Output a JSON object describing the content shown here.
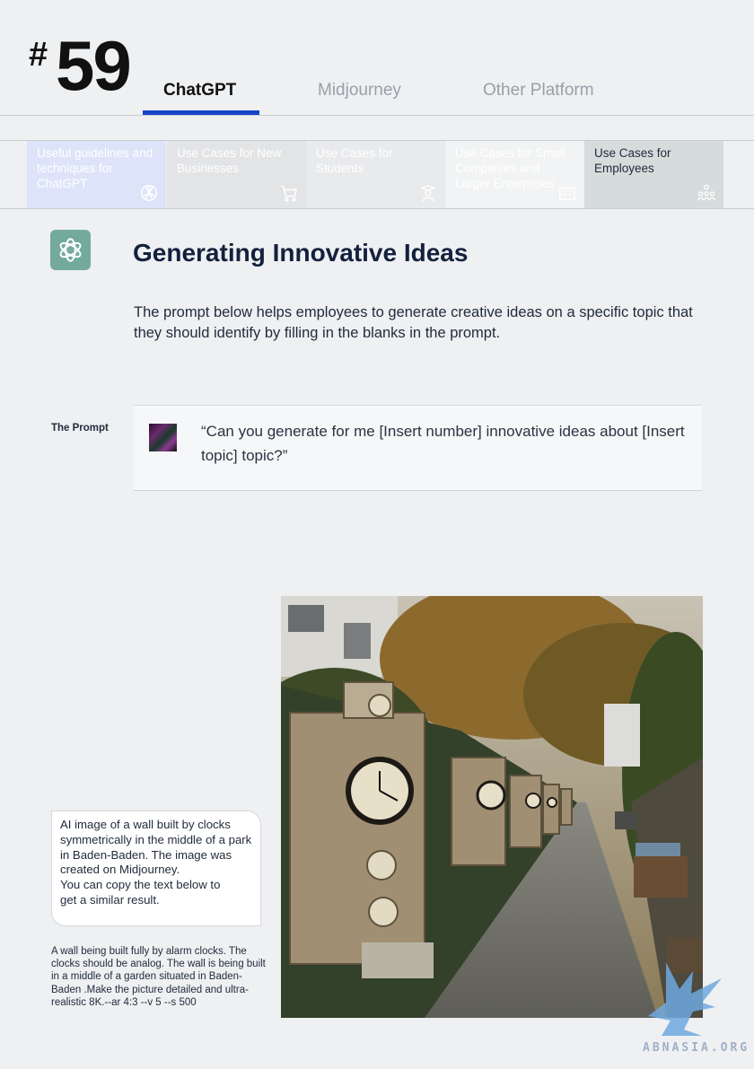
{
  "header": {
    "hash": "#",
    "number": "59",
    "tabs": [
      {
        "label": "ChatGPT",
        "active": true
      },
      {
        "label": "Midjourney",
        "active": false
      },
      {
        "label": "Other Platform",
        "active": false
      }
    ],
    "accent_color": "#1742c9"
  },
  "subtabs": [
    {
      "label": "Useful guidelines and techniques for ChatGPT",
      "icon": "openai-logo-icon"
    },
    {
      "label": "Use Cases for New Businesses",
      "icon": "shopping-cart-icon"
    },
    {
      "label": "Use Cases for Students",
      "icon": "student-icon"
    },
    {
      "label": "Use Cases for Small Companies and Larger Enterprises",
      "icon": "building-icon"
    },
    {
      "label": "Use Cases for Employees",
      "icon": "team-icon",
      "active": true
    }
  ],
  "section": {
    "title": "Generating Innovative Ideas",
    "description": "The prompt below helps employees to generate creative ideas on a specific topic that they should identify by filling in the blanks in the prompt."
  },
  "prompt": {
    "label": "The Prompt",
    "text": "“Can you generate for me [Insert number] innovative ideas about [Insert topic] topic?”"
  },
  "caption": {
    "text": "AI image of a wall built by clocks symmetrically in the middle of a park in Baden-Baden. The image was created on Midjourney.\nYou can copy the text below to\n   get a similar result."
  },
  "midjourney_prompt": "A wall being built fully by alarm clocks. The clocks should be analog. The wall is being built in a middle of a garden situated in Baden-Baden .Make the picture detailed and ultra-realistic 8K.--ar 4:3 --v 5 --s 500",
  "watermark": "ABNASIA.ORG"
}
